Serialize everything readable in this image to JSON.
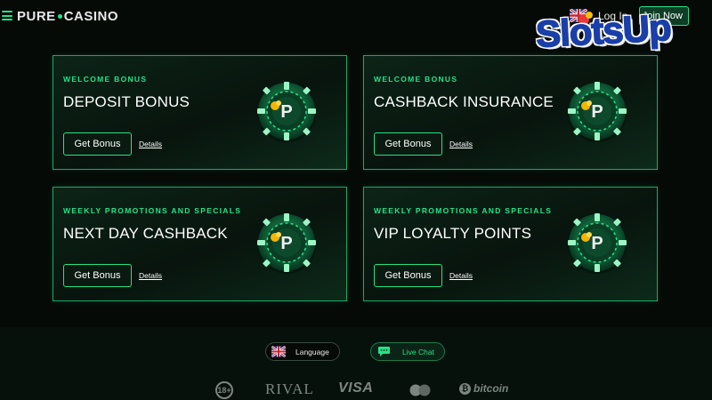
{
  "header": {
    "brand_part1": "PURE",
    "brand_part2": "CASINO",
    "login_label": "Log In",
    "signup_label": "Join Now",
    "accent_color": "#25e28a"
  },
  "watermark": {
    "text": "SlotsUp"
  },
  "cards": [
    {
      "eyebrow": "WELCOME BONUS",
      "title": "DEPOSIT BONUS",
      "cta": "Get Bonus",
      "details": "Details",
      "icon": "casino-chip-icon"
    },
    {
      "eyebrow": "WELCOME BONUS",
      "title": "CASHBACK INSURANCE",
      "cta": "Get Bonus",
      "details": "Details",
      "icon": "casino-chip-icon"
    },
    {
      "eyebrow": "WEEKLY PROMOTIONS AND SPECIALS",
      "title": "NEXT DAY CASHBACK",
      "cta": "Get Bonus",
      "details": "Details",
      "icon": "casino-chip-icon"
    },
    {
      "eyebrow": "WEEKLY PROMOTIONS AND SPECIALS",
      "title": "VIP LOYALTY POINTS",
      "cta": "Get Bonus",
      "details": "Details",
      "icon": "casino-chip-icon"
    }
  ],
  "footer": {
    "language_label": "Language",
    "live_chat_label": "Live Chat",
    "age_badge": "18+",
    "partners": {
      "rival": "RIVAL",
      "visa": "VISA",
      "mastercard": "MasterCard",
      "bitcoin": "bitcoin"
    }
  }
}
